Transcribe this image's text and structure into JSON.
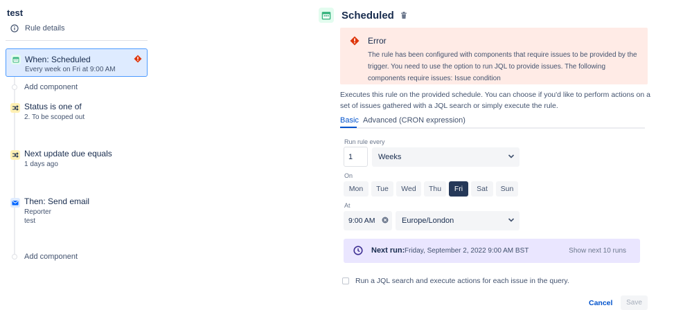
{
  "rule": {
    "title": "test",
    "details_label": "Rule details"
  },
  "components": {
    "trigger": {
      "title": "When: Scheduled",
      "subtitle": "Every week on Fri at 9:00 AM",
      "icon": "calendar-icon",
      "has_error": true
    },
    "add_component_1": "Add component",
    "condition_1": {
      "title": "Status is one of",
      "subtitle": "2. To be scoped out",
      "icon": "shuffle-icon"
    },
    "condition_2": {
      "title": "Next update due equals",
      "subtitle": "1 days ago",
      "icon": "shuffle-icon"
    },
    "action": {
      "title": "Then: Send email",
      "line1": "Reporter",
      "line2": "test",
      "icon": "mail-icon"
    },
    "add_component_2": "Add component"
  },
  "panel": {
    "title": "Scheduled",
    "error": {
      "title": "Error",
      "text": "The rule has been configured with components that require issues to be provided by the trigger. You need to use the option to run JQL to provide issues. The following components require issues: Issue condition"
    },
    "description": "Executes this rule on the provided schedule. You can choose if you'd like to perform actions on a set of issues gathered with a JQL search or simply execute the rule.",
    "tabs": [
      {
        "label": "Basic",
        "active": true
      },
      {
        "label": "Advanced (CRON expression)",
        "active": false
      }
    ],
    "run_every_label": "Run rule every",
    "run_every_value": "1",
    "period": "Weeks",
    "on_label": "On",
    "days": [
      {
        "label": "Mon",
        "selected": false
      },
      {
        "label": "Tue",
        "selected": false
      },
      {
        "label": "Wed",
        "selected": false
      },
      {
        "label": "Thu",
        "selected": false
      },
      {
        "label": "Fri",
        "selected": true
      },
      {
        "label": "Sat",
        "selected": false
      },
      {
        "label": "Sun",
        "selected": false
      }
    ],
    "at_label": "At",
    "time": "9:00 AM",
    "timezone": "Europe/London",
    "next_run_label": "Next run:",
    "next_run_value": "Friday, September 2, 2022 9:00 AM BST",
    "show_next_label": "Show next 10 runs",
    "jql_checkbox_label": "Run a JQL search and execute actions for each issue in the query.",
    "jql_checked": false,
    "cancel_label": "Cancel",
    "save_label": "Save"
  },
  "colors": {
    "accent": "#0052cc",
    "error_bg": "#ffebe6",
    "error_icon": "#de350b",
    "selected_day": "#253858",
    "next_run_bg": "#eae6ff",
    "trigger_bg": "#deebff",
    "trigger_border": "#4c9aff"
  }
}
